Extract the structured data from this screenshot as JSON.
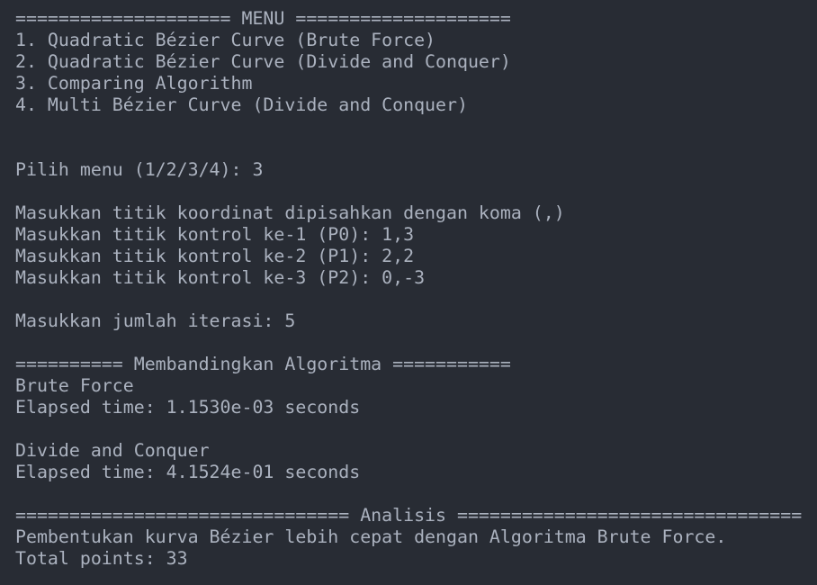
{
  "terminal": {
    "menu_header": "==================== MENU ====================",
    "menu_items": [
      "1. Quadratic Bézier Curve (Brute Force)",
      "2. Quadratic Bézier Curve (Divide and Conquer)",
      "3. Comparing Algorithm",
      "4. Multi Bézier Curve (Divide and Conquer)"
    ],
    "menu_prompt": "Pilih menu (1/2/3/4): 3",
    "coord_instruction": "Masukkan titik koordinat dipisahkan dengan koma (,)",
    "control_points": [
      "Masukkan titik kontrol ke-1 (P0): 1,3",
      "Masukkan titik kontrol ke-2 (P1): 2,2",
      "Masukkan titik kontrol ke-3 (P2): 0,-3"
    ],
    "iterations_prompt": "Masukkan jumlah iterasi: 5",
    "compare_header": "========== Membandingkan Algoritma ===========",
    "brute_force_label": "Brute Force",
    "brute_force_time": "Elapsed time: 1.1530e-03 seconds",
    "dnc_label": "Divide and Conquer",
    "dnc_time": "Elapsed time: 4.1524e-01 seconds",
    "analysis_header": "=============================== Analisis ================================",
    "analysis_result": "Pembentukan kurva Bézier lebih cepat dengan Algoritma Brute Force.",
    "total_points": "Total points: 33"
  }
}
